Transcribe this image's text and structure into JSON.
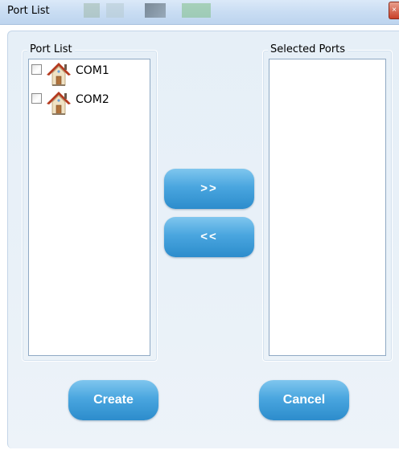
{
  "window": {
    "title": "Port List",
    "close_glyph": "×"
  },
  "port_list": {
    "legend": "Port List",
    "items": [
      {
        "label": "COM1",
        "checked": false,
        "icon": "house-icon"
      },
      {
        "label": "COM2",
        "checked": false,
        "icon": "house-icon"
      }
    ]
  },
  "selected_ports": {
    "legend": "Selected Ports",
    "items": []
  },
  "buttons": {
    "add_label": ">>",
    "remove_label": "<<",
    "create_label": "Create",
    "cancel_label": "Cancel"
  },
  "colors": {
    "button_top": "#7fc6ee",
    "button_bottom": "#2c8ccc",
    "panel_background": "#e6eff7",
    "titlebar": "#c9ddf3"
  }
}
